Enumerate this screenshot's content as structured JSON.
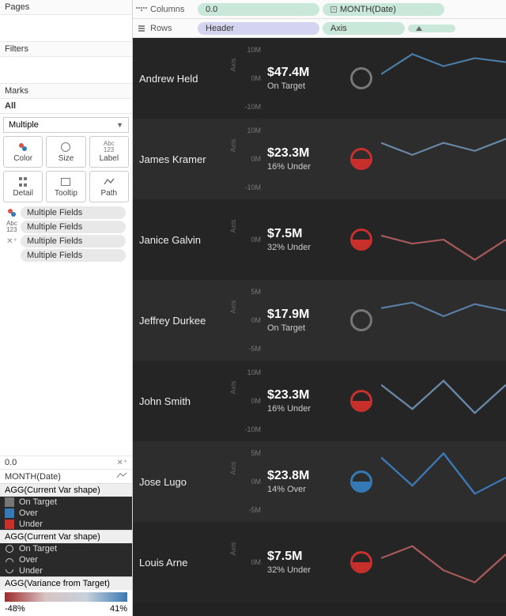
{
  "shelves": {
    "columns_label": "Columns",
    "rows_label": "Rows",
    "col_pills": [
      "0.0",
      "MONTH(Date)"
    ],
    "row_pills": [
      "Header",
      "Axis",
      "Δ"
    ]
  },
  "side": {
    "pages": "Pages",
    "filters": "Filters",
    "marks": "Marks",
    "all": "All",
    "select": "Multiple",
    "btns": {
      "color": "Color",
      "size": "Size",
      "label": "Label",
      "detail": "Detail",
      "tooltip": "Tooltip",
      "path": "Path"
    },
    "fields": [
      "Multiple Fields",
      "Multiple Fields",
      "Multiple Fields",
      "Multiple Fields"
    ],
    "small1_label": "0.0",
    "small2_label": "MONTH(Date)",
    "legend1_title": "AGG(Current Var shape)",
    "legend1_items": [
      {
        "color": "#777777",
        "label": "On Target"
      },
      {
        "color": "#337ab7",
        "label": "Over"
      },
      {
        "color": "#c9302c",
        "label": "Under"
      }
    ],
    "legend2_title": "AGG(Current Var shape)",
    "legend2_items": [
      {
        "shape": "circle",
        "label": "On Target"
      },
      {
        "shape": "half-top",
        "label": "Over"
      },
      {
        "shape": "half-bottom",
        "label": "Under"
      }
    ],
    "legend3_title": "AGG(Variance from Target)",
    "legend3_min": "-48%",
    "legend3_max": "41%"
  },
  "chart_data": {
    "type": "table",
    "rows": [
      {
        "name": "Andrew Held",
        "value": "$47.4M",
        "sub": "On Target",
        "status": "on",
        "ticks": [
          "10M",
          "0M",
          "-10M"
        ],
        "spark": [
          [
            0,
            45
          ],
          [
            30,
            20
          ],
          [
            60,
            35
          ],
          [
            90,
            25
          ],
          [
            120,
            30
          ]
        ],
        "color": "#4a7fa8"
      },
      {
        "name": "James Kramer",
        "value": "$23.3M",
        "sub": "16% Under",
        "status": "under",
        "ticks": [
          "10M",
          "0M",
          "-10M"
        ],
        "spark": [
          [
            0,
            30
          ],
          [
            30,
            45
          ],
          [
            60,
            30
          ],
          [
            90,
            40
          ],
          [
            120,
            25
          ]
        ],
        "color": "#6a89a8"
      },
      {
        "name": "Janice Galvin",
        "value": "$7.5M",
        "sub": "32% Under",
        "status": "under",
        "ticks": [
          "",
          "0M",
          ""
        ],
        "spark": [
          [
            0,
            45
          ],
          [
            30,
            55
          ],
          [
            60,
            50
          ],
          [
            90,
            75
          ],
          [
            120,
            50
          ]
        ],
        "color": "#a85a5a"
      },
      {
        "name": "Jeffrey Durkee",
        "value": "$17.9M",
        "sub": "On Target",
        "status": "on",
        "ticks": [
          "5M",
          "0M",
          "-5M"
        ],
        "spark": [
          [
            0,
            35
          ],
          [
            30,
            28
          ],
          [
            60,
            45
          ],
          [
            90,
            30
          ],
          [
            120,
            38
          ]
        ],
        "color": "#5a80a8"
      },
      {
        "name": "John Smith",
        "value": "$23.3M",
        "sub": "16% Under",
        "status": "under",
        "ticks": [
          "10M",
          "0M",
          "-10M"
        ],
        "spark": [
          [
            0,
            30
          ],
          [
            30,
            60
          ],
          [
            60,
            25
          ],
          [
            90,
            65
          ],
          [
            120,
            30
          ]
        ],
        "color": "#6a89a8"
      },
      {
        "name": "Jose Lugo",
        "value": "$23.8M",
        "sub": "14% Over",
        "status": "over",
        "ticks": [
          "5M",
          "0M",
          "-5M"
        ],
        "spark": [
          [
            0,
            20
          ],
          [
            30,
            55
          ],
          [
            60,
            15
          ],
          [
            90,
            65
          ],
          [
            120,
            45
          ]
        ],
        "color": "#3b78b4"
      },
      {
        "name": "Louis Arne",
        "value": "$7.5M",
        "sub": "32% Under",
        "status": "under",
        "ticks": [
          "",
          "0M",
          ""
        ],
        "spark": [
          [
            0,
            45
          ],
          [
            30,
            30
          ],
          [
            60,
            60
          ],
          [
            90,
            75
          ],
          [
            120,
            40
          ]
        ],
        "color": "#a85a5a"
      }
    ]
  }
}
